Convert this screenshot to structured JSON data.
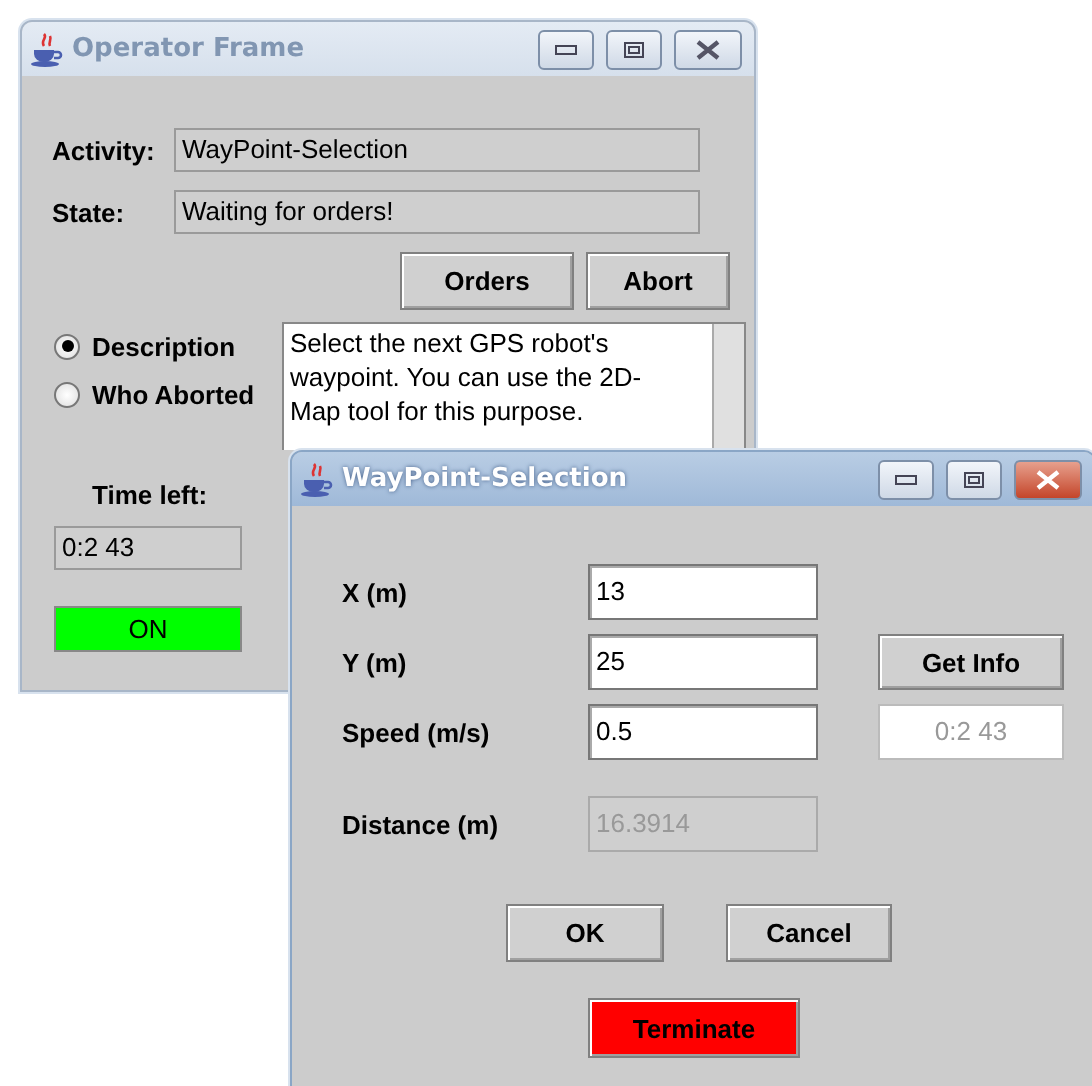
{
  "operator_frame": {
    "title": "Operator Frame",
    "active": false,
    "activity": {
      "label": "Activity:",
      "value": "WayPoint-Selection"
    },
    "state": {
      "label": "State:",
      "value": "Waiting for orders!"
    },
    "buttons": [
      "Orders",
      "Abort"
    ],
    "views": [
      {
        "label": "Description",
        "selected": true
      },
      {
        "label": "Who Aborted",
        "selected": false
      }
    ],
    "description": "Select the next GPS robot's waypoint. You can use the 2D-Map tool for this purpose.",
    "time_left": {
      "label": "Time left:",
      "value": "0:2 43"
    },
    "indicator": {
      "label": "ON",
      "on": true
    }
  },
  "waypoint_dialog": {
    "title": "WayPoint-Selection",
    "active": true,
    "fields": [
      {
        "label": "X (m)",
        "value": "13",
        "disabled": false
      },
      {
        "label": "Y (m)",
        "value": "25",
        "disabled": false
      },
      {
        "label": "Speed (m/s)",
        "value": "0.5",
        "disabled": false
      },
      {
        "label": "Distance (m)",
        "value": "16.3914",
        "disabled": true
      }
    ],
    "get_info": "Get Info",
    "time_display": {
      "value": "0:2 43",
      "disabled": true
    },
    "buttons": [
      "OK",
      "Cancel"
    ],
    "terminate": "Terminate"
  }
}
